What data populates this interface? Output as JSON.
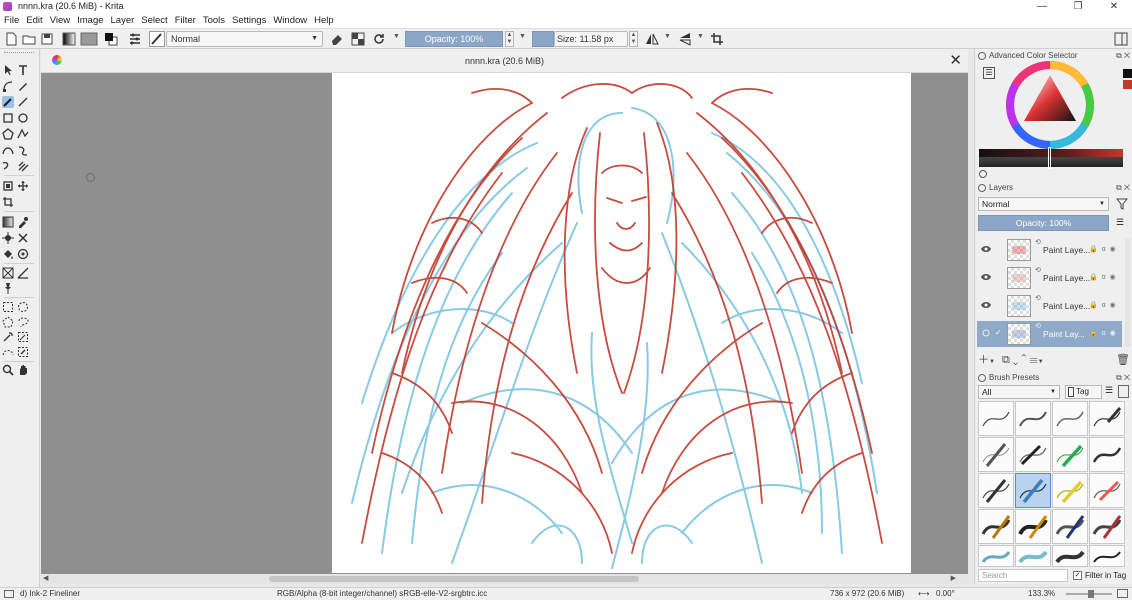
{
  "window": {
    "title": "nnnn.kra (20.6 MiB)  - Krita",
    "minimize": "—",
    "maximize": "❐",
    "close": "✕"
  },
  "menu": [
    "File",
    "Edit",
    "View",
    "Image",
    "Layer",
    "Select",
    "Filter",
    "Tools",
    "Settings",
    "Window",
    "Help"
  ],
  "toolbar": {
    "blend_mode": "Normal",
    "opacity": "Opacity: 100%",
    "size": "Size: 11.58 px"
  },
  "document": {
    "tab_title": "nnnn.kra (20.6 MiB)",
    "close": "✕"
  },
  "panels": {
    "color_selector": {
      "title": "Advanced Color Selector",
      "current_color": "#111111"
    },
    "layers": {
      "title": "Layers",
      "blend_mode": "Normal",
      "opacity": "Opacity:  100%",
      "items": [
        {
          "name": "Paint Laye...",
          "thumb_tint": "#e06060",
          "selected": false
        },
        {
          "name": "Paint Laye...",
          "thumb_tint": "#e0a0a0",
          "selected": false
        },
        {
          "name": "Paint Laye...",
          "thumb_tint": "#7cc0e0",
          "selected": false
        },
        {
          "name": "Paint Lay...",
          "thumb_tint": "#7ca0c8",
          "selected": true
        }
      ]
    },
    "brush_presets": {
      "title": "Brush Presets",
      "filter": "All",
      "tag_label": "Tag",
      "search_placeholder": "Search",
      "filter_in_tag": "Filter in Tag"
    }
  },
  "status": {
    "brush": "d) Ink-2 Fineliner",
    "color_space": "RGB/Alpha (8-bit integer/channel)  sRGB-elle-V2-srgbtrc.icc",
    "dimensions": "736 x 972 (20.6 MiB)",
    "rotation": "0.00°",
    "zoom": "133.3%"
  },
  "colors": {
    "accent": "#8ba6c6",
    "sketch_red": "#c0392b",
    "sketch_blue": "#7cc4e4"
  }
}
